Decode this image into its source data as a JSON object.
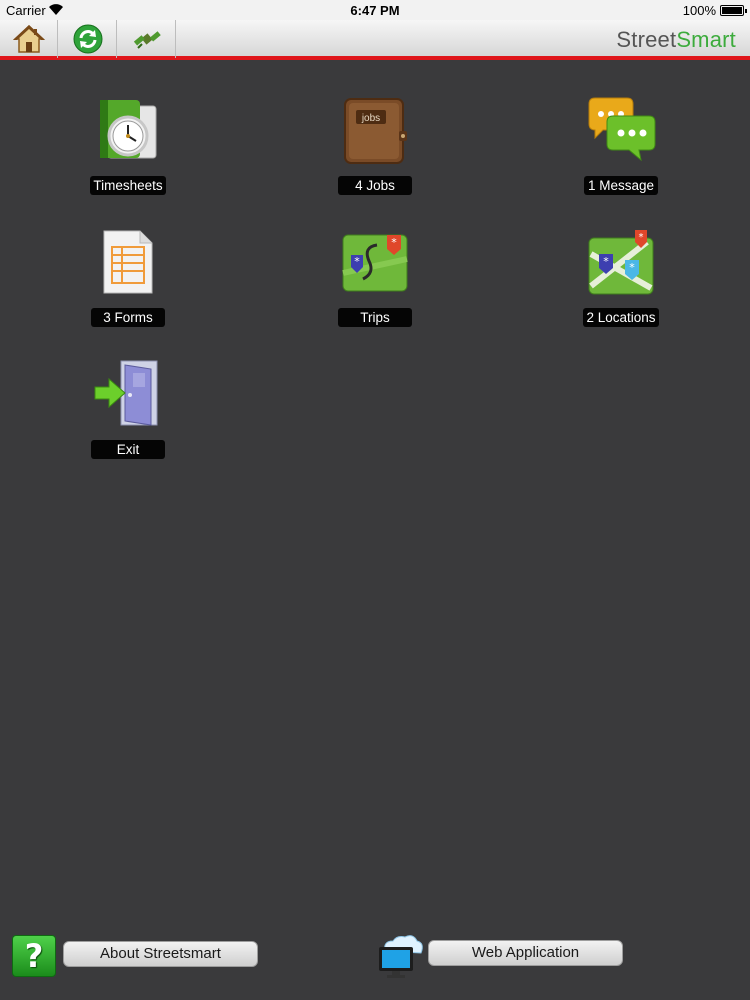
{
  "status_bar": {
    "carrier": "Carrier",
    "time": "6:47 PM",
    "battery": "100%"
  },
  "toolbar": {
    "brand_part1": "Street",
    "brand_part2": "Smart",
    "buttons": [
      "home-icon",
      "sync-icon",
      "gps-satellite-icon"
    ]
  },
  "tiles": {
    "timesheets": {
      "label": "Timesheets",
      "icon": "timesheets-clock-icon"
    },
    "jobs": {
      "label": "4 Jobs",
      "icon": "jobs-wallet-icon",
      "icon_text": "jobs"
    },
    "message": {
      "label": "1 Message",
      "icon": "chat-bubbles-icon"
    },
    "forms": {
      "label": "3 Forms",
      "icon": "form-document-icon"
    },
    "trips": {
      "label": "Trips",
      "icon": "route-map-icon"
    },
    "locations": {
      "label": "2 Locations",
      "icon": "locations-map-icon"
    },
    "exit": {
      "label": "Exit",
      "icon": "exit-door-icon"
    }
  },
  "bottom": {
    "help_glyph": "?",
    "about_label": "About Streetsmart",
    "web_label": "Web Application"
  },
  "colors": {
    "background": "#3a3a3c",
    "accent_red": "#e0161b",
    "brand_green": "#3cab3c"
  }
}
